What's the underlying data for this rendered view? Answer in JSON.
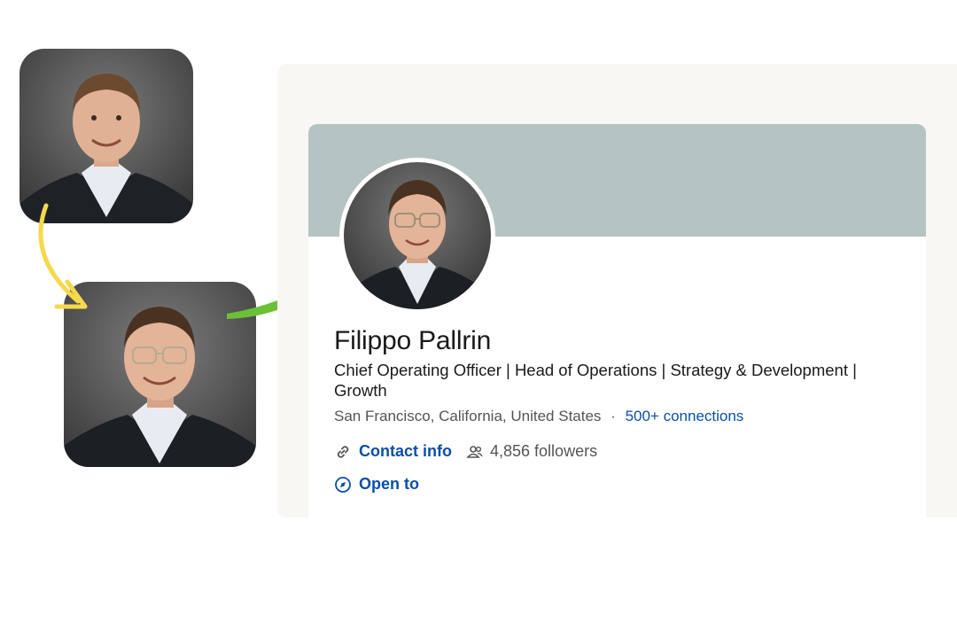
{
  "profile": {
    "name": "Filippo Pallrin",
    "headline": "Chief Operating Officer | Head of Operations | Strategy & Development | Growth",
    "location": "San Francisco, California, United States",
    "separator": "·",
    "connections": "500+ connections",
    "contact_info": "Contact info",
    "followers": "4,856 followers",
    "open_to": "Open to"
  },
  "icons": {
    "contact": "link-icon",
    "followers": "people-icon",
    "open_to": "compass-icon",
    "arrow_1": "curved-arrow-icon",
    "arrow_2": "curved-arrow-icon"
  },
  "colors": {
    "banner": "#b5c4c3",
    "link": "#0a4fa8",
    "arrow_yellow": "#f4d94c",
    "arrow_green": "#6cc036",
    "panel": "#f8f7f4"
  }
}
